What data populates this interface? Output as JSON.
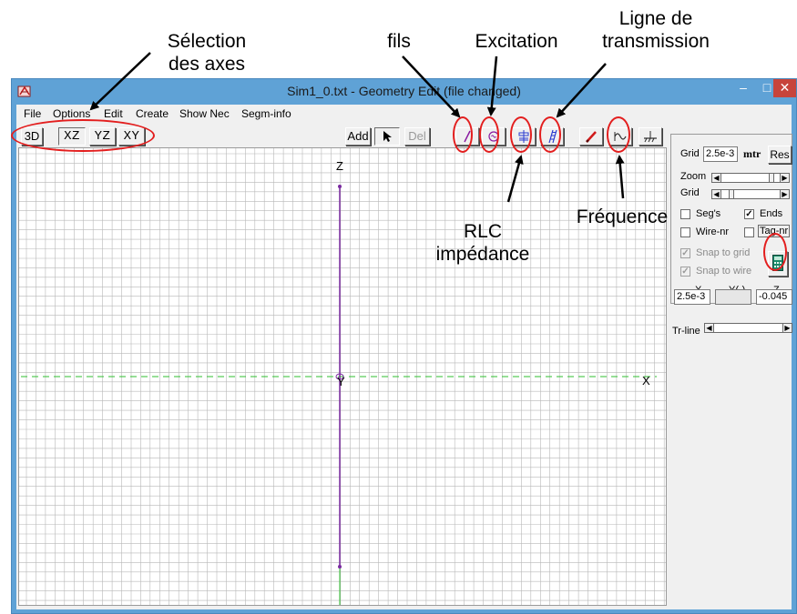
{
  "annotations": {
    "axes_selection": "Sélection\ndes axes",
    "wires": "fils",
    "excitation": "Excitation",
    "transmission_line": "Ligne de\ntransmission",
    "rlc_impedance": "RLC\nimpédance",
    "frequency": "Fréquence"
  },
  "window": {
    "title": "Sim1_0.txt - Geometry Edit (file changed)"
  },
  "menu": [
    "File",
    "Options",
    "Edit",
    "Create",
    "Show Nec",
    "Segm-info"
  ],
  "toolbar": {
    "view_3d": "3D",
    "view_xz": "XZ",
    "view_yz": "YZ",
    "view_xy": "XY",
    "add": "Add",
    "del": "Del"
  },
  "canvas": {
    "axis_labels": {
      "z": "Z",
      "y": "Y",
      "x": "X"
    },
    "colors": {
      "grid": "#b8b8b8",
      "wire": "#7a2aa0",
      "axis": "#2fbf2f"
    }
  },
  "side_panel": {
    "grid_label": "Grid",
    "grid_value": "2.5e-3",
    "unit": "mtr",
    "res_button": "Res",
    "zoom_label": "Zoom",
    "grid_scroll_label": "Grid",
    "segs_label": "Seg's",
    "segs_checked": false,
    "ends_label": "Ends",
    "ends_checked": true,
    "wirenr_label": "Wire-nr",
    "wirenr_checked": false,
    "tagnr_label": "Tag-nr",
    "tagnr_checked": false,
    "snap_grid_label": "Snap to grid",
    "snap_grid_checked": true,
    "snap_wire_label": "Snap to wire",
    "snap_wire_checked": true,
    "coord_x_label": "X",
    "coord_y_label": "Y(-)",
    "coord_z_label": "Z",
    "coord_x_value": "2.5e-3",
    "coord_y_value": "",
    "coord_z_value": "-0.045",
    "trline_label": "Tr-line"
  }
}
